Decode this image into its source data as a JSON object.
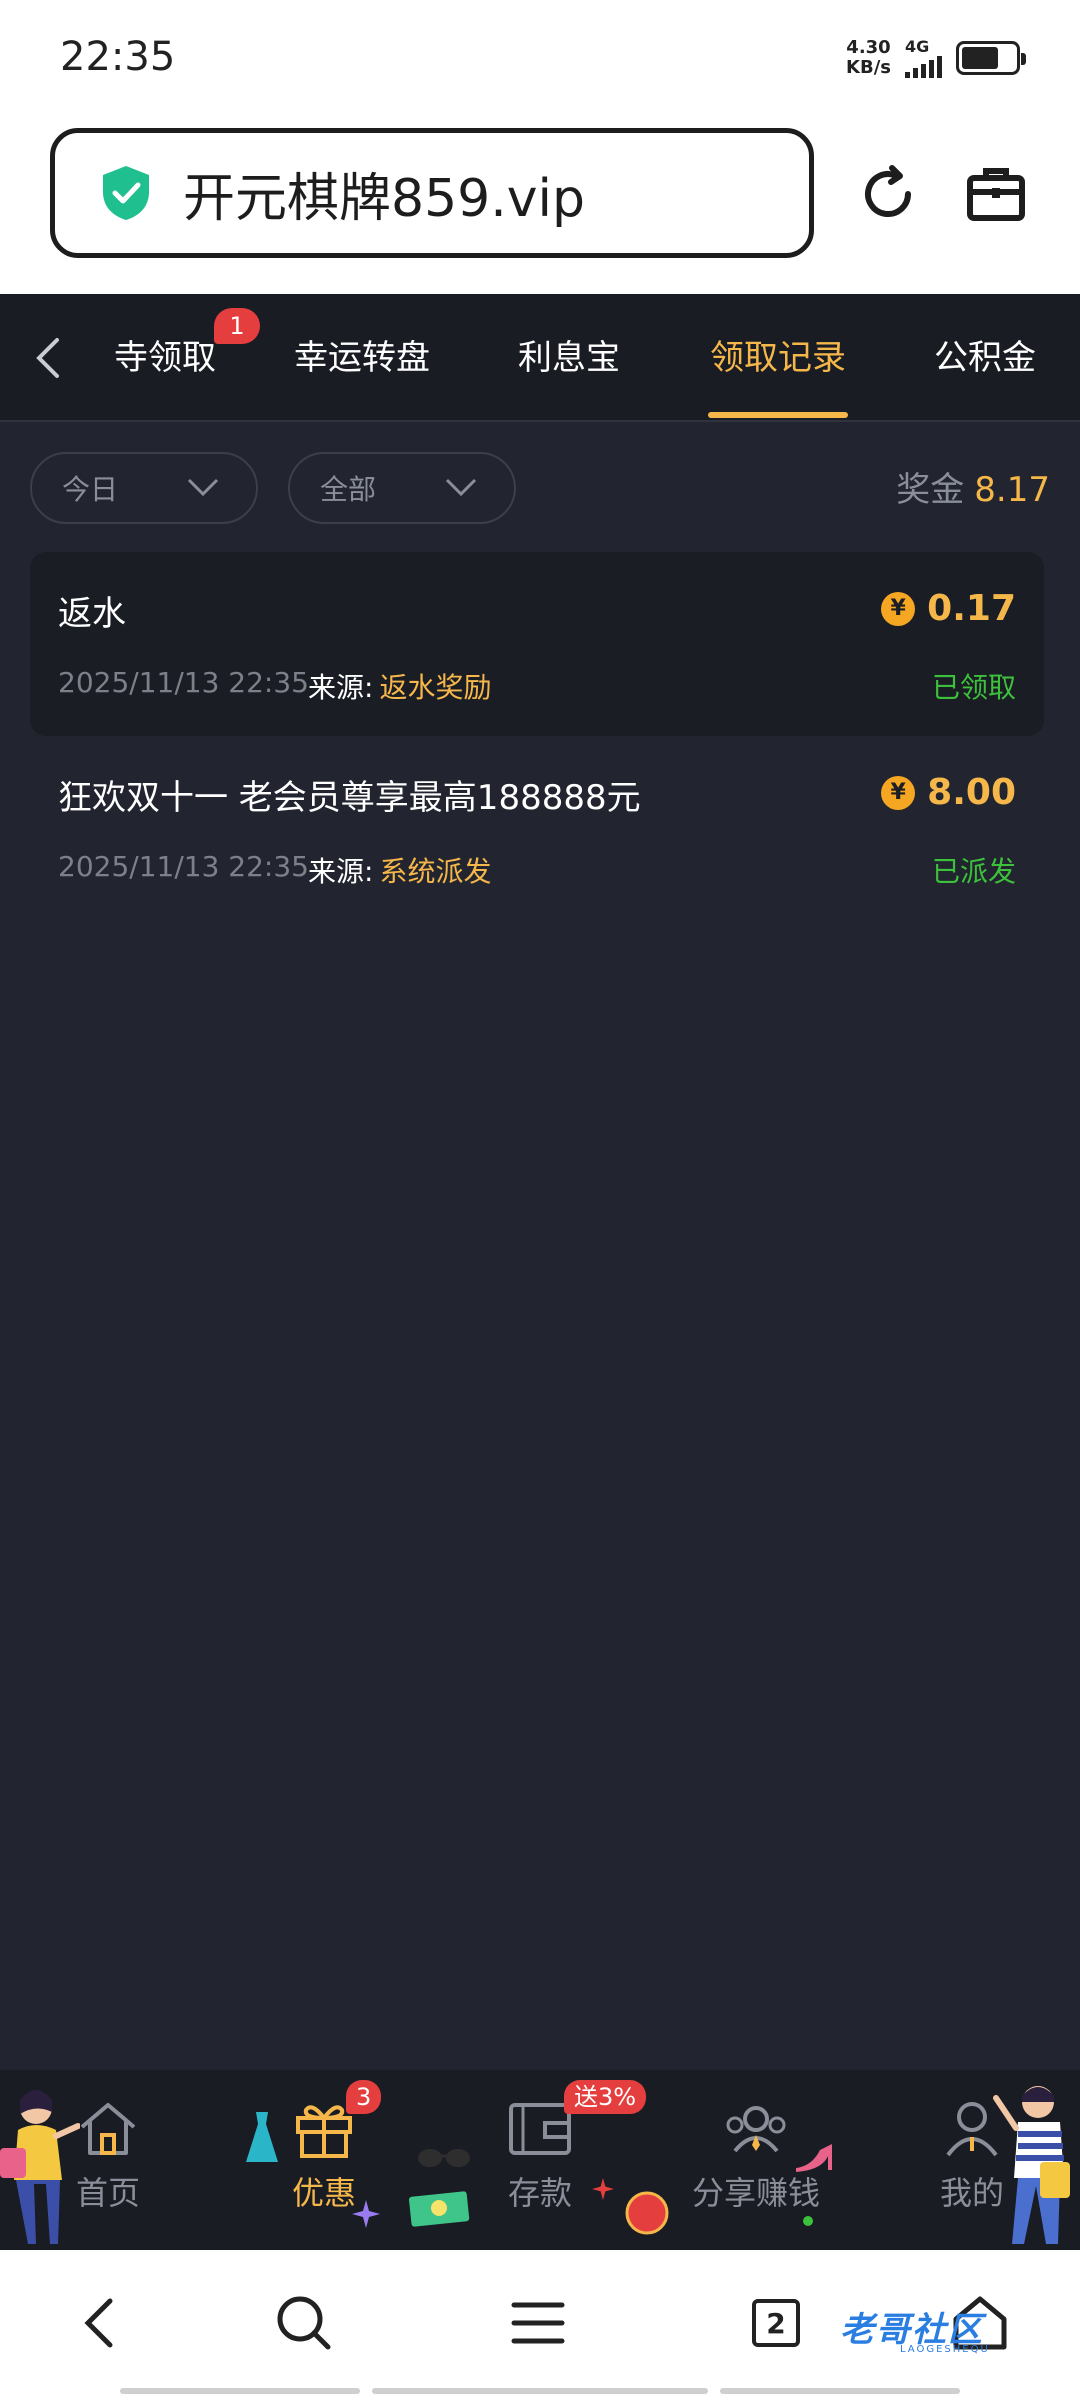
{
  "status_bar": {
    "time": "22:35",
    "net_speed_value": "4.30",
    "net_speed_unit": "KB/s",
    "network": "4G"
  },
  "browser": {
    "url": "开元棋牌859.vip",
    "icons": [
      "shield-check-icon",
      "refresh-icon",
      "briefcase-icon"
    ]
  },
  "tabs": {
    "items": [
      {
        "label": "寺领取",
        "badge": "1"
      },
      {
        "label": "幸运转盘"
      },
      {
        "label": "利息宝"
      },
      {
        "label": "领取记录",
        "active": true
      },
      {
        "label": "公积金"
      }
    ]
  },
  "filters": {
    "date": "今日",
    "type": "全部",
    "bonus_label": "奖金",
    "bonus_value": "8.17"
  },
  "records": [
    {
      "title": "返水",
      "amount": "0.17",
      "date": "2025/11/13 22:35",
      "source_label": "来源:",
      "source": "返水奖励",
      "status": "已领取"
    },
    {
      "title": "狂欢双十一 老会员尊享最高188888元",
      "amount": "8.00",
      "date": "2025/11/13 22:35",
      "source_label": "来源:",
      "source": "系统派发",
      "status": "已派发"
    }
  ],
  "bottom_nav": {
    "items": [
      {
        "label": "首页",
        "icon": "home-icon"
      },
      {
        "label": "优惠",
        "icon": "gift-icon",
        "badge": "3",
        "active": true
      },
      {
        "label": "存款",
        "icon": "wallet-icon",
        "badge": "送3%"
      },
      {
        "label": "分享赚钱",
        "icon": "share-people-icon"
      },
      {
        "label": "我的",
        "icon": "user-icon"
      }
    ]
  },
  "system_nav": {
    "tab_count": "2"
  },
  "watermark": {
    "text": "老哥社区",
    "sub": "LAOGESHEQU"
  },
  "colors": {
    "accent": "#f5b74a",
    "background": "#22252f",
    "success": "#3cc13b",
    "badge": "#e53e3e"
  }
}
